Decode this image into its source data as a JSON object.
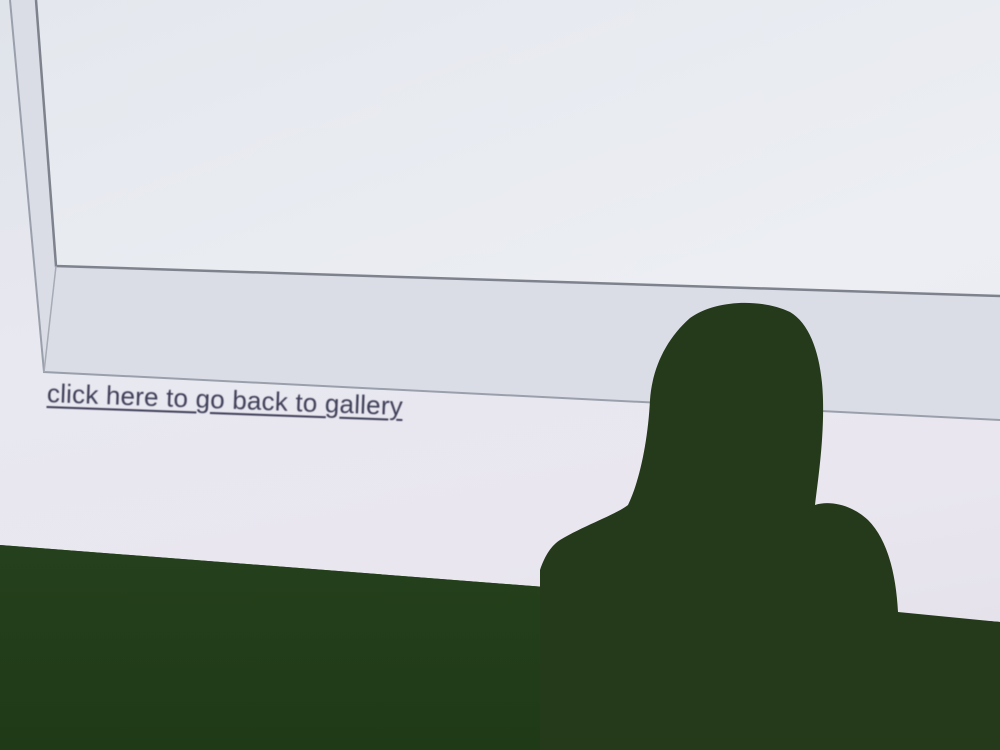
{
  "link": {
    "gallery_back": "click here to go back to gallery"
  },
  "colors": {
    "projection": "#e6e6ee",
    "frame": "#dadde6",
    "shadow": "#24381a",
    "floor": "#2c4a22",
    "link_text": "#3e3e58"
  }
}
